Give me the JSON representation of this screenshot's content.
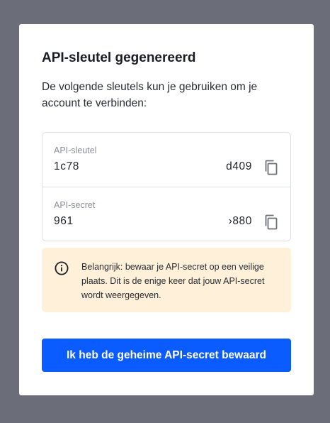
{
  "modal": {
    "title": "API-sleutel gegenereerd",
    "intro": "De volgende sleutels kun je gebruiken om je account te verbinden:",
    "keys": [
      {
        "label": "API-sleutel",
        "value_start": "1c78",
        "value_end": "d409",
        "copy_icon": "copy-icon"
      },
      {
        "label": "API-secret",
        "value_start": "961",
        "value_end": "›880",
        "copy_icon": "copy-icon"
      }
    ],
    "notice": {
      "icon": "info-icon",
      "text": "Belangrijk: bewaar je API-secret op een veilige plaats. Dit is de enige keer dat jouw API-secret wordt weergegeven.",
      "background": "#fff0d9"
    },
    "confirm_label": "Ik heb de geheime API-secret bewaard",
    "accent": "#0a5cff"
  }
}
